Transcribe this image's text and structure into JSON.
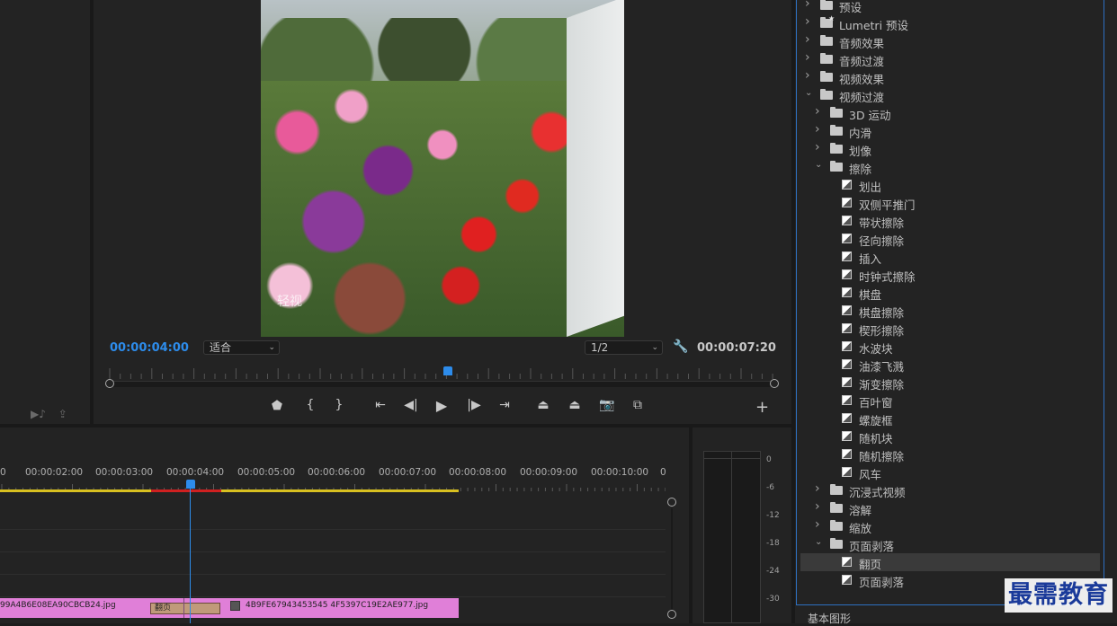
{
  "program_monitor": {
    "current_timecode": "00:00:04:00",
    "duration_timecode": "00:00:07:20",
    "fit_dropdown": "适合",
    "resolution_dropdown": "1/2",
    "watermark_in_video": "轻视"
  },
  "timeline": {
    "ruler_labels": [
      "0",
      "00:00:02:00",
      "00:00:03:00",
      "00:00:04:00",
      "00:00:05:00",
      "00:00:06:00",
      "00:00:07:00",
      "00:00:08:00",
      "00:00:09:00",
      "00:00:10:00",
      "0"
    ],
    "clip_left_name": "99A4B6E08EA90CBCB24.jpg",
    "transition_label": "翻页",
    "clip_right_name": "4B9FE67943453545 4F5397C19E2AE977.jpg"
  },
  "audio_meter": {
    "labels": [
      "0",
      "-6",
      "-12",
      "-18",
      "-24",
      "-30"
    ]
  },
  "effects_tree": {
    "items": [
      {
        "label": "预设",
        "level": 0,
        "type": "folder",
        "expanded": false
      },
      {
        "label": "Lumetri 预设",
        "level": 0,
        "type": "preset-folder",
        "expanded": false
      },
      {
        "label": "音频效果",
        "level": 0,
        "type": "folder",
        "expanded": false
      },
      {
        "label": "音频过渡",
        "level": 0,
        "type": "folder",
        "expanded": false
      },
      {
        "label": "视频效果",
        "level": 0,
        "type": "folder",
        "expanded": false
      },
      {
        "label": "视频过渡",
        "level": 0,
        "type": "folder",
        "expanded": true
      },
      {
        "label": "3D 运动",
        "level": 1,
        "type": "folder",
        "expanded": false
      },
      {
        "label": "内滑",
        "level": 1,
        "type": "folder",
        "expanded": false
      },
      {
        "label": "划像",
        "level": 1,
        "type": "folder",
        "expanded": false
      },
      {
        "label": "擦除",
        "level": 1,
        "type": "folder",
        "expanded": true
      },
      {
        "label": "划出",
        "level": 2,
        "type": "effect"
      },
      {
        "label": "双侧平推门",
        "level": 2,
        "type": "effect"
      },
      {
        "label": "带状擦除",
        "level": 2,
        "type": "effect"
      },
      {
        "label": "径向擦除",
        "level": 2,
        "type": "effect"
      },
      {
        "label": "插入",
        "level": 2,
        "type": "effect"
      },
      {
        "label": "时钟式擦除",
        "level": 2,
        "type": "effect"
      },
      {
        "label": "棋盘",
        "level": 2,
        "type": "effect"
      },
      {
        "label": "棋盘擦除",
        "level": 2,
        "type": "effect"
      },
      {
        "label": "楔形擦除",
        "level": 2,
        "type": "effect"
      },
      {
        "label": "水波块",
        "level": 2,
        "type": "effect"
      },
      {
        "label": "油漆飞溅",
        "level": 2,
        "type": "effect"
      },
      {
        "label": "渐变擦除",
        "level": 2,
        "type": "effect"
      },
      {
        "label": "百叶窗",
        "level": 2,
        "type": "effect"
      },
      {
        "label": "螺旋框",
        "level": 2,
        "type": "effect"
      },
      {
        "label": "随机块",
        "level": 2,
        "type": "effect"
      },
      {
        "label": "随机擦除",
        "level": 2,
        "type": "effect"
      },
      {
        "label": "风车",
        "level": 2,
        "type": "effect"
      },
      {
        "label": "沉浸式视频",
        "level": 1,
        "type": "folder",
        "expanded": false
      },
      {
        "label": "溶解",
        "level": 1,
        "type": "folder",
        "expanded": false
      },
      {
        "label": "缩放",
        "level": 1,
        "type": "folder",
        "expanded": false
      },
      {
        "label": "页面剥落",
        "level": 1,
        "type": "folder",
        "expanded": true
      },
      {
        "label": "翻页",
        "level": 2,
        "type": "effect",
        "selected": true
      },
      {
        "label": "页面剥落",
        "level": 2,
        "type": "effect"
      }
    ],
    "footer_label": "基本图形"
  },
  "watermark": "最需教育",
  "colors": {
    "accent": "#2d8ceb",
    "clip": "#e07fd8",
    "work_area": "#d8c020",
    "selection_border": "#2d6fc0"
  }
}
